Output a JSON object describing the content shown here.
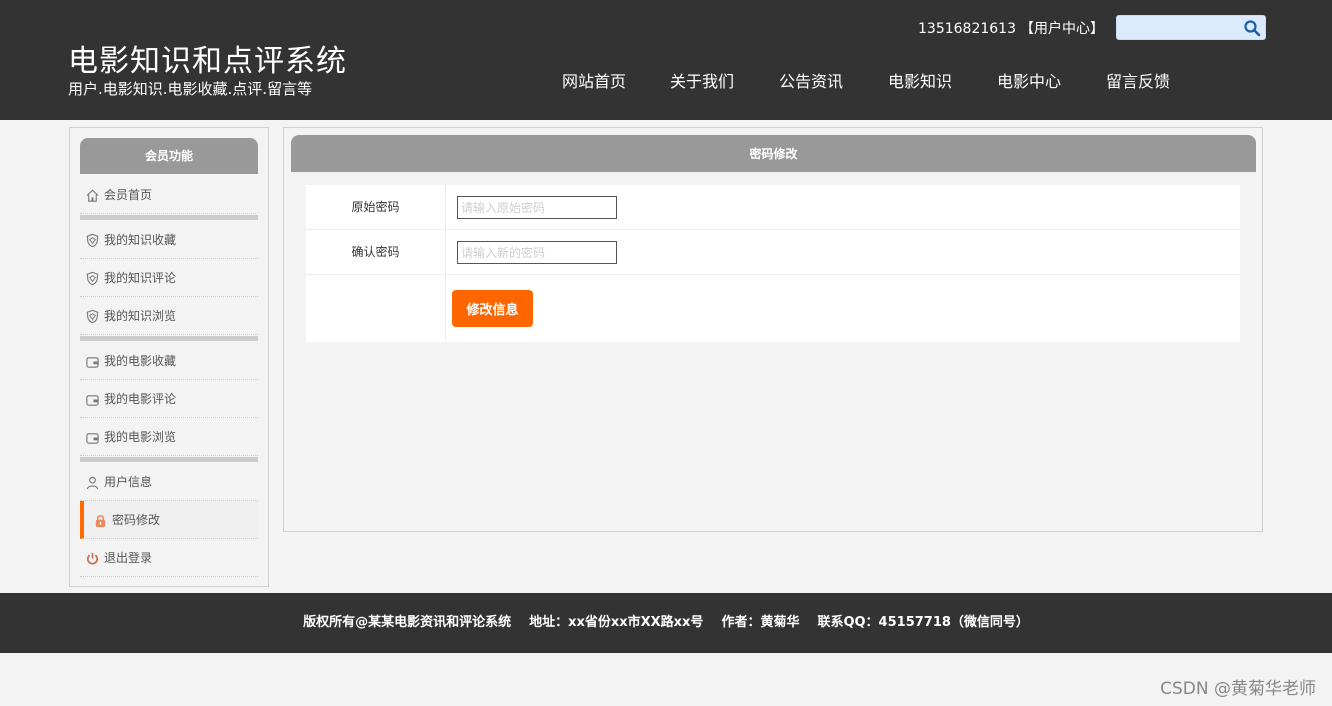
{
  "header": {
    "site_title": "电影知识和点评系统",
    "site_subtitle": "用户.电影知识.电影收藏.点评.留言等",
    "username": "13516821613",
    "user_center": "【用户中心】",
    "search_placeholder": "",
    "nav": [
      "网站首页",
      "关于我们",
      "公告资讯",
      "电影知识",
      "电影中心",
      "留言反馈"
    ]
  },
  "sidebar": {
    "title": "会员功能",
    "items": [
      {
        "label": "会员首页",
        "icon": "home-icon"
      },
      {
        "label": "我的知识收藏",
        "icon": "shield-icon"
      },
      {
        "label": "我的知识评论",
        "icon": "shield-icon"
      },
      {
        "label": "我的知识浏览",
        "icon": "shield-icon"
      },
      {
        "label": "我的电影收藏",
        "icon": "wallet-icon"
      },
      {
        "label": "我的电影评论",
        "icon": "wallet-icon"
      },
      {
        "label": "我的电影浏览",
        "icon": "wallet-icon"
      },
      {
        "label": "用户信息",
        "icon": "user-icon"
      },
      {
        "label": "密码修改",
        "icon": "lock-icon",
        "active": true
      },
      {
        "label": "退出登录",
        "icon": "power-icon"
      }
    ]
  },
  "main": {
    "title": "密码修改",
    "fields": [
      {
        "label": "原始密码",
        "placeholder": "请输入原始密码"
      },
      {
        "label": "确认密码",
        "placeholder": "请输入新的密码"
      }
    ],
    "submit_label": "修改信息"
  },
  "footer": {
    "copyright": "版权所有@某某电影资讯和评论系统",
    "address": "地址：xx省份xx市XX路xx号",
    "author": "作者：黄菊华",
    "contact": "联系QQ：45157718（微信同号）"
  },
  "watermark": "CSDN @黄菊华老师",
  "colors": {
    "header_bg": "#333333",
    "accent": "#ff6600",
    "panel_head": "#999999"
  }
}
